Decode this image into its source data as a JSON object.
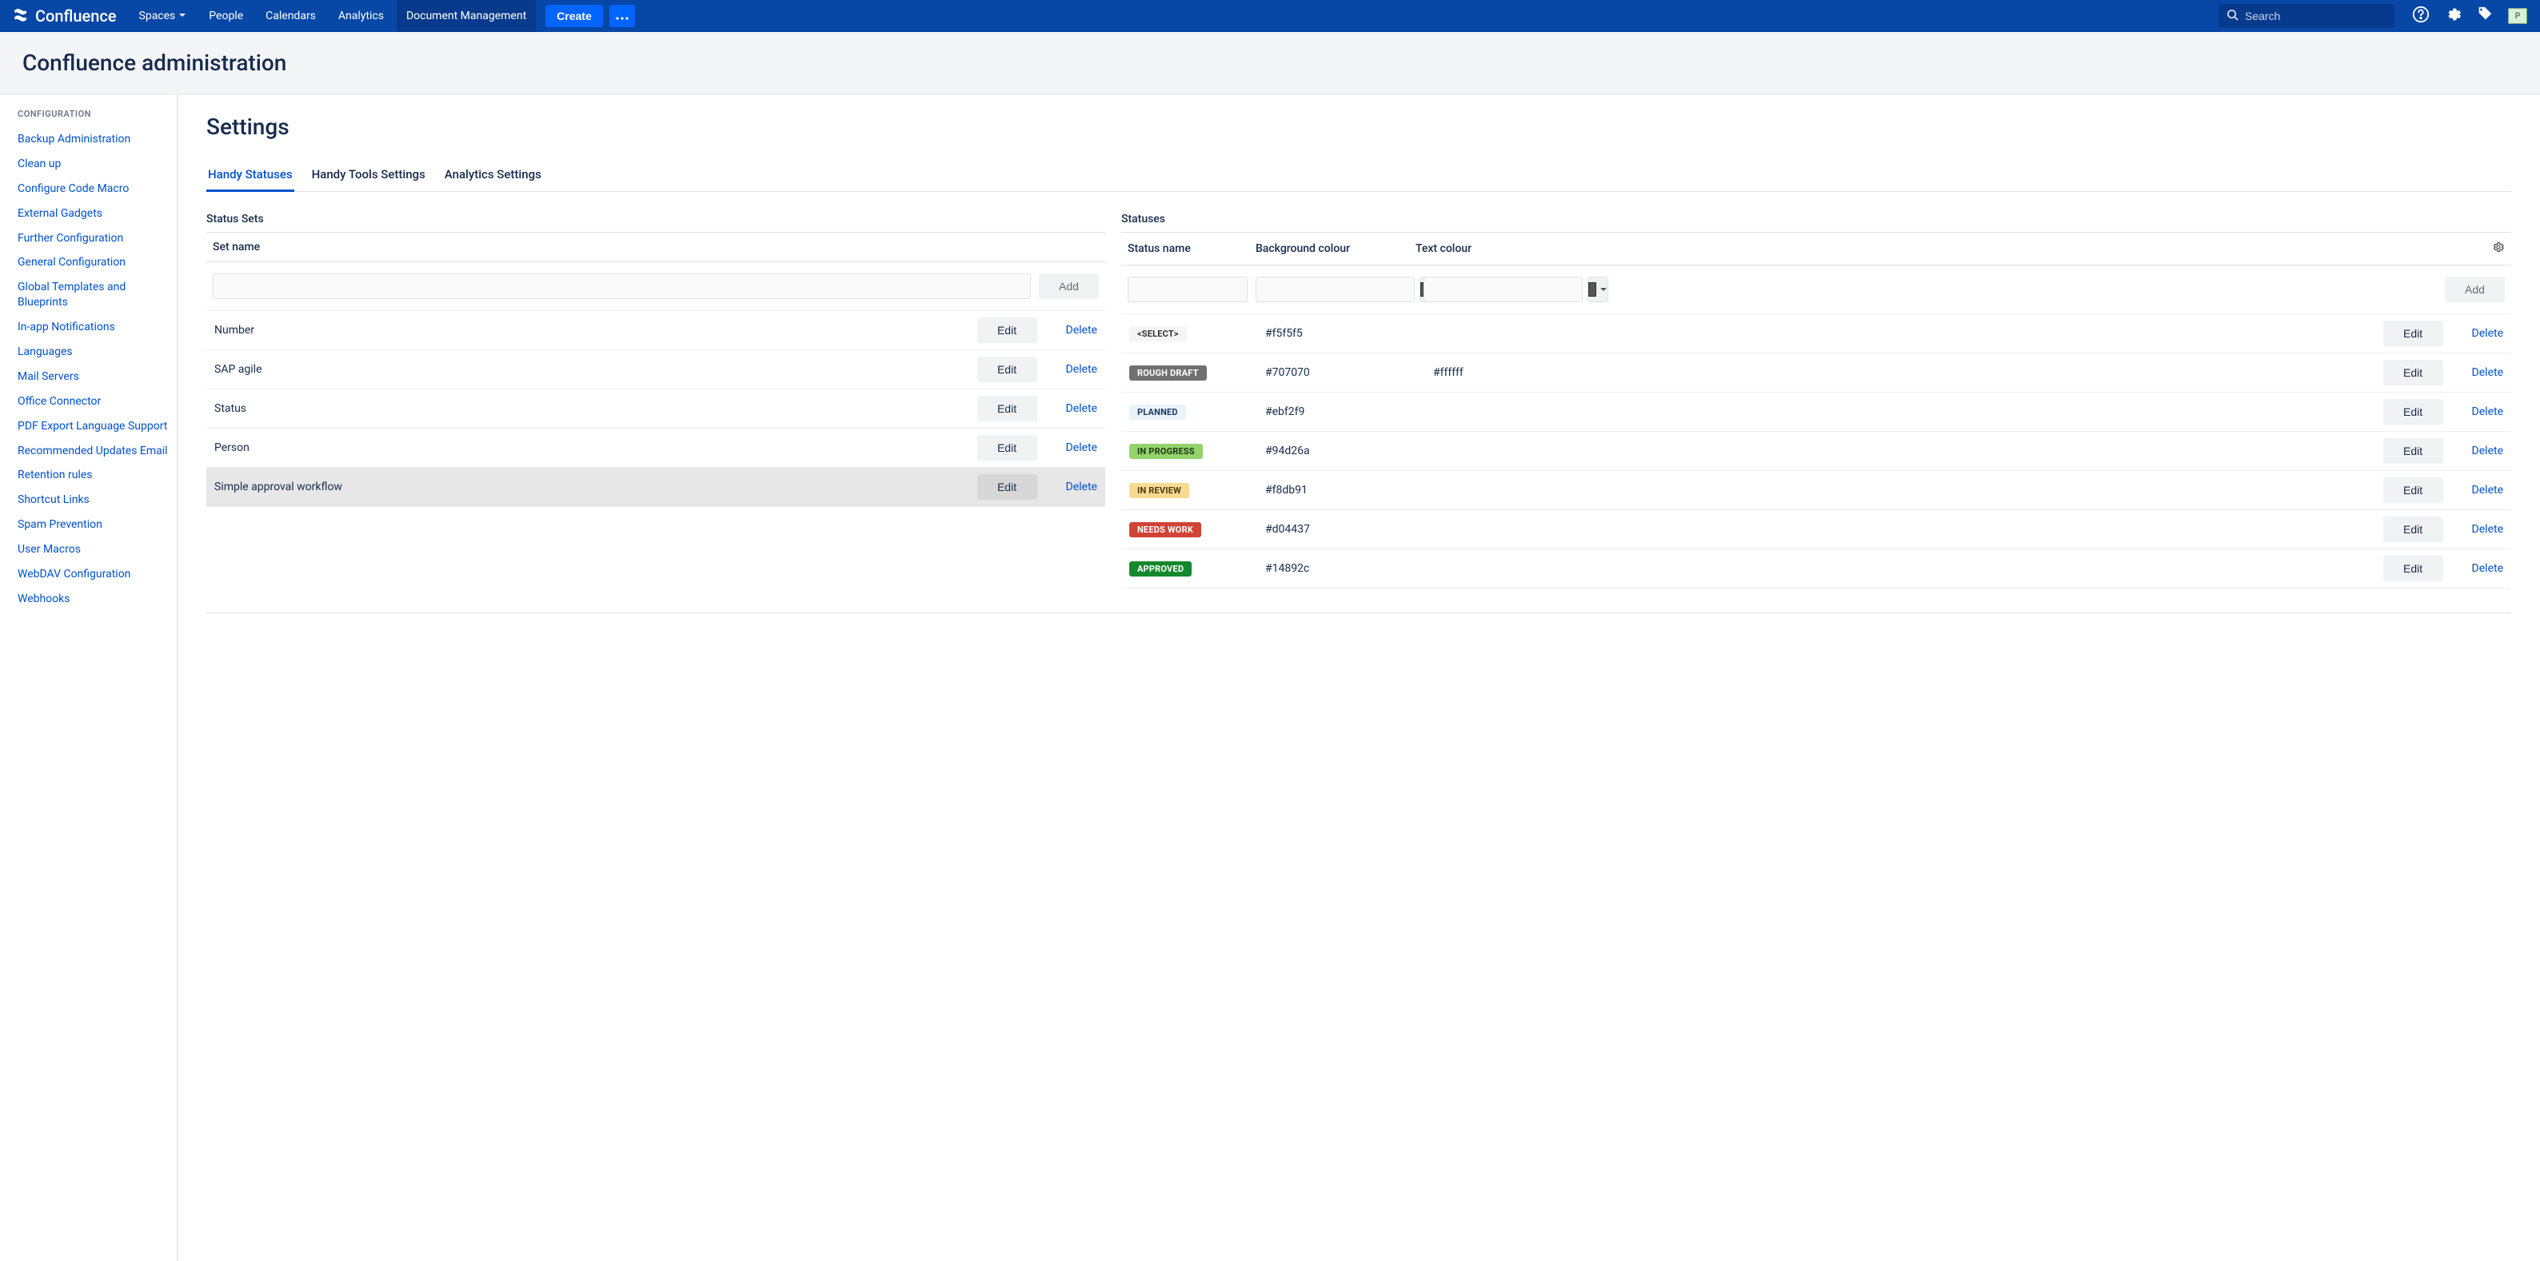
{
  "header": {
    "brand": "Confluence",
    "nav": {
      "spaces": "Spaces",
      "people": "People",
      "calendars": "Calendars",
      "analytics": "Analytics",
      "docmgmt": "Document Management"
    },
    "create": "Create",
    "search_placeholder": "Search",
    "avatar_alt": "P"
  },
  "page_title": "Confluence administration",
  "sidebar": {
    "heading": "CONFIGURATION",
    "items": [
      "Backup Administration",
      "Clean up",
      "Configure Code Macro",
      "External Gadgets",
      "Further Configuration",
      "General Configuration",
      "Global Templates and Blueprints",
      "In-app Notifications",
      "Languages",
      "Mail Servers",
      "Office Connector",
      "PDF Export Language Support",
      "Recommended Updates Email",
      "Retention rules",
      "Shortcut Links",
      "Spam Prevention",
      "User Macros",
      "WebDAV Configuration",
      "Webhooks"
    ]
  },
  "main": {
    "title": "Settings",
    "tabs": [
      "Handy Statuses",
      "Handy Tools Settings",
      "Analytics Settings"
    ],
    "active_tab": 0,
    "section_sets": "Status Sets",
    "section_statuses": "Statuses",
    "col_set_name": "Set name",
    "col_status_name": "Status name",
    "col_bg": "Background colour",
    "col_text": "Text colour",
    "btn_add": "Add",
    "btn_edit": "Edit",
    "btn_delete": "Delete",
    "sets": [
      {
        "name": "Number",
        "selected": false
      },
      {
        "name": "SAP agile",
        "selected": false
      },
      {
        "name": "Status",
        "selected": false
      },
      {
        "name": "Person",
        "selected": false
      },
      {
        "name": "Simple approval workflow",
        "selected": true
      }
    ],
    "statuses": [
      {
        "label": "<SELECT>",
        "bg": "#f5f5f5",
        "text": "",
        "loz_bg": "#f5f5f5",
        "loz_text": "#333333"
      },
      {
        "label": "ROUGH DRAFT",
        "bg": "#707070",
        "text": "#ffffff",
        "loz_bg": "#707070",
        "loz_text": "#ffffff"
      },
      {
        "label": "PLANNED",
        "bg": "#ebf2f9",
        "text": "",
        "loz_bg": "#ebf2f9",
        "loz_text": "#1a3b66"
      },
      {
        "label": "IN PROGRESS",
        "bg": "#94d26a",
        "text": "",
        "loz_bg": "#94d26a",
        "loz_text": "#1e3a12"
      },
      {
        "label": "IN REVIEW",
        "bg": "#f8db91",
        "text": "",
        "loz_bg": "#f8db91",
        "loz_text": "#4a3a10"
      },
      {
        "label": "NEEDS WORK",
        "bg": "#d04437",
        "text": "",
        "loz_bg": "#d04437",
        "loz_text": "#ffffff"
      },
      {
        "label": "APPROVED",
        "bg": "#14892c",
        "text": "",
        "loz_bg": "#14892c",
        "loz_text": "#ffffff"
      }
    ]
  }
}
